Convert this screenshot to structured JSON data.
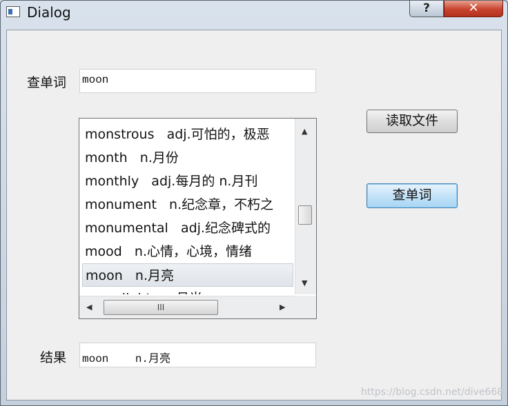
{
  "window": {
    "title": "Dialog",
    "help_label": "?",
    "close_label": "✕"
  },
  "search": {
    "label": "查单词",
    "value": "moon"
  },
  "wordlist": {
    "items": [
      {
        "text": "monstrous   adj.可怕的，极恶"
      },
      {
        "text": "month   n.月份"
      },
      {
        "text": "monthly   adj.每月的 n.月刊"
      },
      {
        "text": "monument   n.纪念章，不朽之"
      },
      {
        "text": "monumental   adj.纪念碑式的"
      },
      {
        "text": "mood   n.心情，心境，情绪"
      },
      {
        "text": "moon   n.月亮",
        "selected": true
      },
      {
        "text": "moonlight   n.月光"
      }
    ],
    "hscroll_grip": "III"
  },
  "buttons": {
    "read_file": "读取文件",
    "lookup": "查单词"
  },
  "result": {
    "label": "结果",
    "value": "moon    n.月亮"
  },
  "watermark": "https://blog.csdn.net/dive668"
}
